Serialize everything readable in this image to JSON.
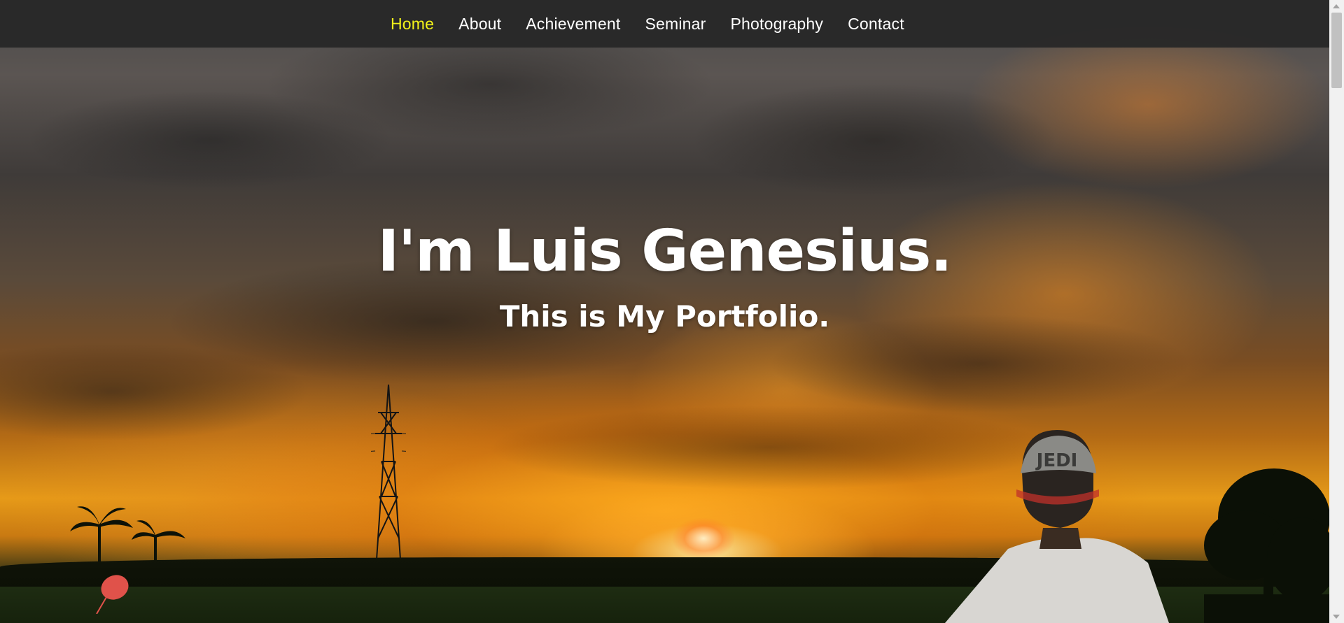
{
  "navbar": {
    "items": [
      {
        "label": "Home",
        "active": true
      },
      {
        "label": "About",
        "active": false
      },
      {
        "label": "Achievement",
        "active": false
      },
      {
        "label": "Seminar",
        "active": false
      },
      {
        "label": "Photography",
        "active": false
      },
      {
        "label": "Contact",
        "active": false
      }
    ],
    "active_color": "#f2f21a",
    "text_color": "#ffffff",
    "background": "#282828"
  },
  "hero": {
    "title": "I'm Luis Genesius.",
    "subtitle": "This is My Portfolio.",
    "cap_text": "JEDI"
  }
}
